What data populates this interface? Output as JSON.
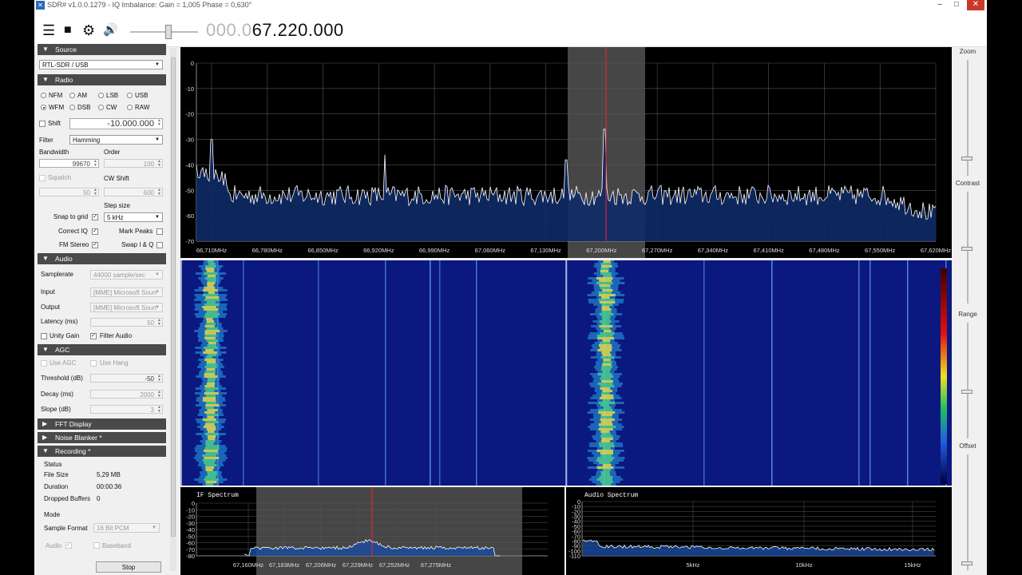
{
  "window": {
    "title": "SDR# v1.0.0.1279 - IQ Imbalance: Gain = 1,005 Phase = 0,630°",
    "min_btn": "–",
    "max_btn": "□",
    "close_btn": "✕"
  },
  "toolbar": {
    "menu_icon": "☰",
    "stop_icon": "■",
    "settings_icon": "⚙",
    "volume_icon": "🔊",
    "volume_level": 0.55,
    "freq_dim": "000.0",
    "freq_bright": "67.220.000"
  },
  "source": {
    "title": "Source",
    "device": "RTL-SDR / USB"
  },
  "radio": {
    "title": "Radio",
    "modes": [
      "NFM",
      "AM",
      "LSB",
      "USB",
      "WFM",
      "DSB",
      "CW",
      "RAW"
    ],
    "selected": "WFM",
    "shift_label": "Shift",
    "shift_value": "-10.000.000",
    "filter_label": "Filter",
    "filter_value": "Hamming",
    "bandwidth_label": "Bandwidth",
    "bandwidth_value": "99670",
    "order_label": "Order",
    "order_value": "100",
    "squelch_label": "Squelch",
    "squelch_value": "50",
    "cwshift_label": "CW Shift",
    "cwshift_value": "600",
    "stepsize_label": "Step size",
    "snap_label": "Snap to grid",
    "step_value": "5 kHz",
    "correctiq_label": "Correct IQ",
    "markpeaks_label": "Mark Peaks",
    "fmstereo_label": "FM Stereo",
    "swapiq_label": "Swap I & Q"
  },
  "audio": {
    "title": "Audio",
    "samplerate_label": "Samplerate",
    "samplerate_value": "44000 sample/sec",
    "input_label": "Input",
    "input_value": "[MME] Microsoft Soun",
    "output_label": "Output",
    "output_value": "[MME] Microsoft Soun",
    "latency_label": "Latency (ms)",
    "latency_value": "50",
    "unity_label": "Unity Gain",
    "filteraudio_label": "Filter Audio"
  },
  "agc": {
    "title": "AGC",
    "use_agc": "Use AGC",
    "use_hang": "Use Hang",
    "threshold_label": "Threshold (dB)",
    "threshold_value": "-50",
    "decay_label": "Decay (ms)",
    "decay_value": "2000",
    "slope_label": "Slope (dB)",
    "slope_value": "3"
  },
  "collapsed": {
    "fft": "FFT Display",
    "nb": "Noise Blanker *"
  },
  "recording": {
    "title": "Recording *",
    "status_label": "Status",
    "filesize_label": "File Size",
    "filesize_value": "5,29 MB",
    "duration_label": "Duration",
    "duration_value": "00:00:36",
    "dropped_label": "Dropped Buffers",
    "dropped_value": "0",
    "mode_label": "Mode",
    "format_label": "Sample Format",
    "format_value": "16 Bit PCM",
    "audio_label": "Audio",
    "baseband_label": "Baseband",
    "stop_label": "Stop"
  },
  "spectrum": {
    "y_ticks": [
      "0",
      "-10",
      "-20",
      "-30",
      "-40",
      "-50",
      "-60",
      "-70"
    ],
    "x_ticks": [
      "66,710MHz",
      "66,780MHz",
      "66,850MHz",
      "66,920MHz",
      "66,990MHz",
      "67,060MHz",
      "67,130MHz",
      "67,200MHz",
      "67,270MHz",
      "67,340MHz",
      "67,410MHz",
      "67,480MHz",
      "67,550MHz",
      "67,620MHz"
    ]
  },
  "if_spectrum": {
    "title": "IF Spectrum",
    "y_ticks": [
      "0",
      "-10",
      "-20",
      "-30",
      "-40",
      "-50",
      "-60",
      "-70",
      "-80"
    ],
    "x_ticks": [
      "67,160MHz",
      "67,183MHz",
      "67,206MHz",
      "67,229MHz",
      "67,252MHz",
      "67,275MHz"
    ]
  },
  "audio_spectrum": {
    "title": "Audio Spectrum",
    "y_ticks": [
      "0",
      "-10",
      "-20",
      "-30",
      "-40",
      "-50",
      "-60",
      "-70",
      "-80",
      "-90",
      "-100",
      "-110"
    ],
    "x_ticks": [
      "5kHz",
      "10kHz",
      "15kHz"
    ]
  },
  "right": {
    "zoom": "Zoom",
    "contrast": "Contrast",
    "range": "Range",
    "offset": "Offset"
  },
  "colors": {
    "spectrum_line": "#ffffff",
    "spectrum_fill": "#0e2a66",
    "tune_marker": "#ff2020",
    "waterfall_bg": "#0a1880",
    "passband": "#808080"
  }
}
